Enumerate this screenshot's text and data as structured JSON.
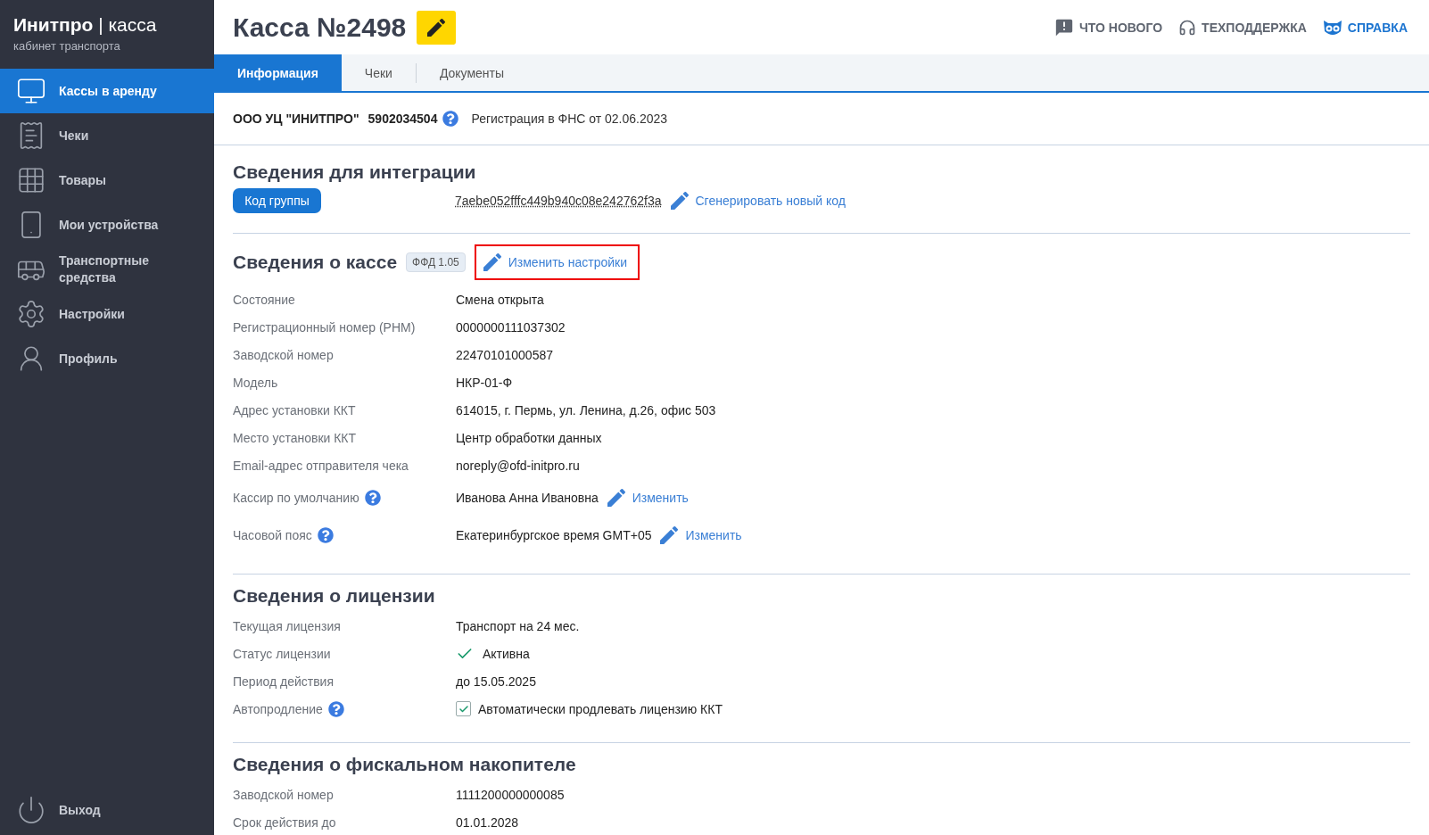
{
  "brand": {
    "name": "Инитпро",
    "separator": "|",
    "product": "касса",
    "subtitle": "кабинет транспорта"
  },
  "sidebar": {
    "items": [
      {
        "label": "Кассы в аренду",
        "selected": true
      },
      {
        "label": "Чеки",
        "selected": false
      },
      {
        "label": "Товары",
        "selected": false
      },
      {
        "label": "Мои устройства",
        "selected": false
      },
      {
        "label": "Транспортные средства",
        "selected": false
      },
      {
        "label": "Настройки",
        "selected": false
      },
      {
        "label": "Профиль",
        "selected": false
      }
    ],
    "logout": "Выход"
  },
  "page": {
    "title": "Касса №2498"
  },
  "top_links": [
    {
      "label": "ЧТО НОВОГО",
      "highlighted": false
    },
    {
      "label": "ТЕХПОДДЕРЖКА",
      "highlighted": false
    },
    {
      "label": "СПРАВКА",
      "highlighted": true
    }
  ],
  "tabs": [
    {
      "label": "Информация",
      "selected": true
    },
    {
      "label": "Чеки",
      "selected": false
    },
    {
      "label": "Документы",
      "selected": false
    }
  ],
  "org": {
    "name": "ООО УЦ \"ИНИТПРО\"",
    "inn": "5902034504",
    "registration": "Регистрация в ФНС от 02.06.2023"
  },
  "integration": {
    "title": "Сведения для интеграции",
    "group_code_button": "Код группы",
    "code": "7aebe052fffc449b940c08e242762f3a",
    "generate_link": "Сгенерировать новый код"
  },
  "kassa": {
    "title": "Сведения о кассе",
    "badge": "ФФД 1.05",
    "edit_link": "Изменить настройки",
    "outlined": true,
    "rows": [
      {
        "label": "Состояние",
        "value": "Смена открыта",
        "help": false
      },
      {
        "label": "Регистрационный номер (РНМ)",
        "value": "0000000111037302",
        "help": false
      },
      {
        "label": "Заводской номер",
        "value": "22470101000587",
        "help": false
      },
      {
        "label": "Модель",
        "value": "НКР-01-Ф",
        "help": false
      },
      {
        "label": "Адрес установки ККТ",
        "value": "614015, г. Пермь, ул. Ленина, д.26, офис 503",
        "help": false
      },
      {
        "label": "Место установки ККТ",
        "value": "Центр обработки данных",
        "help": false
      },
      {
        "label": "Email-адрес отправителя чека",
        "value": "noreply@ofd-initpro.ru",
        "help": false
      },
      {
        "label": "Кассир по умолчанию",
        "value": "Иванова Анна Ивановна",
        "help": true,
        "action": "Изменить"
      },
      {
        "label": "Часовой пояс",
        "value": "Екатеринбургское время GMT+05",
        "help": true,
        "action": "Изменить"
      }
    ]
  },
  "license": {
    "title": "Сведения о лицензии",
    "rows": [
      {
        "kind": "text",
        "label": "Текущая лицензия",
        "value": "Транспорт на 24 мес.",
        "help": false
      },
      {
        "kind": "status",
        "label": "Статус лицензии",
        "value": "Активна",
        "help": false
      },
      {
        "kind": "text",
        "label": "Период действия",
        "value": "до 15.05.2025",
        "help": false
      },
      {
        "kind": "checkbox",
        "label": "Автопродление",
        "value": "Автоматически продлевать лицензию ККТ",
        "help": true,
        "checked": true
      }
    ]
  },
  "fiscal": {
    "title": "Сведения о фискальном накопителе",
    "rows": [
      {
        "label": "Заводской номер",
        "value": "1111200000000085",
        "help": false
      },
      {
        "label": "Срок действия до",
        "value": "01.01.2028",
        "help": false
      }
    ]
  }
}
